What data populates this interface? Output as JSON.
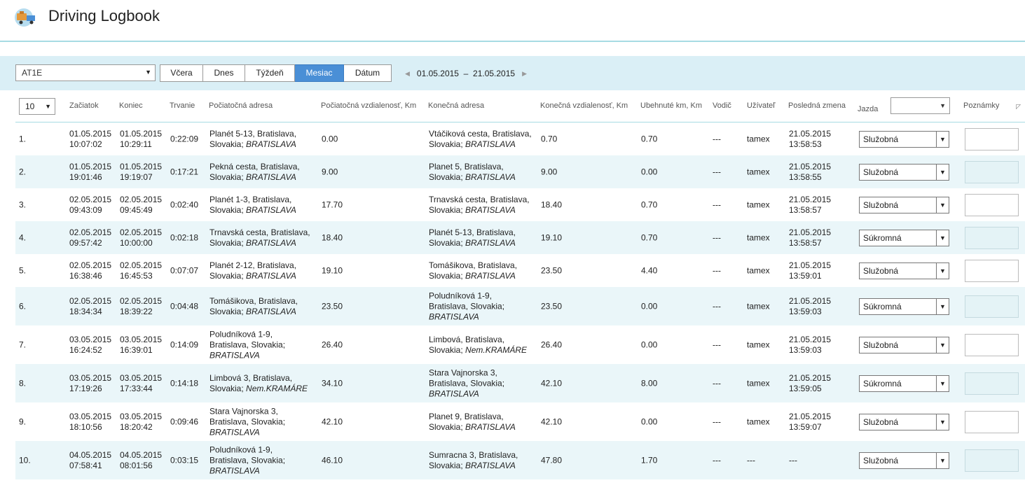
{
  "header": {
    "title": "Driving Logbook",
    "logo_icon": "truck-icon"
  },
  "toolbar": {
    "vehicle": "AT1E",
    "periods": [
      "Včera",
      "Dnes",
      "Týždeň",
      "Mesiac",
      "Dátum"
    ],
    "active_period": "Mesiac",
    "date_from": "01.05.2015",
    "date_sep": "–",
    "date_to": "21.05.2015"
  },
  "table": {
    "page_size": "10",
    "columns": {
      "start": "Začiatok",
      "end": "Koniec",
      "duration": "Trvanie",
      "start_addr": "Počiatočná adresa",
      "start_dist": "Počiatočná vzdialenosť, Km",
      "end_addr": "Konečná adresa",
      "end_dist": "Konečná vzdialenosť, Km",
      "driven": "Ubehnuté km, Km",
      "driver": "Vodič",
      "user": "Užívateľ",
      "last_change": "Posledná zmena",
      "trip": "Jazda",
      "notes": "Poznámky"
    },
    "rows": [
      {
        "n": "1.",
        "sd": "01.05.2015",
        "st": "10:07:02",
        "ed": "01.05.2015",
        "et": "10:29:11",
        "dur": "0:22:09",
        "sa": [
          "Planét 5-13, Bratislava,",
          "Slovakia; "
        ],
        "sc": "BRATISLAVA",
        "sdist": "0.00",
        "ea": [
          "Vtáčiková cesta, Bratislava,",
          "Slovakia; "
        ],
        "ec": "BRATISLAVA",
        "edist": "0.70",
        "km": "0.70",
        "driver": "---",
        "user": "tamex",
        "ld": "21.05.2015",
        "lt": "13:58:53",
        "trip": "Služobná"
      },
      {
        "n": "2.",
        "sd": "01.05.2015",
        "st": "19:01:46",
        "ed": "01.05.2015",
        "et": "19:19:07",
        "dur": "0:17:21",
        "sa": [
          "Pekná cesta, Bratislava,",
          "Slovakia; "
        ],
        "sc": "BRATISLAVA",
        "sdist": "9.00",
        "ea": [
          "Planet 5, Bratislava,",
          "Slovakia; "
        ],
        "ec": "BRATISLAVA",
        "edist": "9.00",
        "km": "0.00",
        "driver": "---",
        "user": "tamex",
        "ld": "21.05.2015",
        "lt": "13:58:55",
        "trip": "Služobná"
      },
      {
        "n": "3.",
        "sd": "02.05.2015",
        "st": "09:43:09",
        "ed": "02.05.2015",
        "et": "09:45:49",
        "dur": "0:02:40",
        "sa": [
          "Planét 1-3, Bratislava,",
          "Slovakia; "
        ],
        "sc": "BRATISLAVA",
        "sdist": "17.70",
        "ea": [
          "Trnavská cesta, Bratislava,",
          "Slovakia; "
        ],
        "ec": "BRATISLAVA",
        "edist": "18.40",
        "km": "0.70",
        "driver": "---",
        "user": "tamex",
        "ld": "21.05.2015",
        "lt": "13:58:57",
        "trip": "Služobná"
      },
      {
        "n": "4.",
        "sd": "02.05.2015",
        "st": "09:57:42",
        "ed": "02.05.2015",
        "et": "10:00:00",
        "dur": "0:02:18",
        "sa": [
          "Trnavská cesta, Bratislava,",
          "Slovakia; "
        ],
        "sc": "BRATISLAVA",
        "sdist": "18.40",
        "ea": [
          "Planét 5-13, Bratislava,",
          "Slovakia; "
        ],
        "ec": "BRATISLAVA",
        "edist": "19.10",
        "km": "0.70",
        "driver": "---",
        "user": "tamex",
        "ld": "21.05.2015",
        "lt": "13:58:57",
        "trip": "Súkromná"
      },
      {
        "n": "5.",
        "sd": "02.05.2015",
        "st": "16:38:46",
        "ed": "02.05.2015",
        "et": "16:45:53",
        "dur": "0:07:07",
        "sa": [
          "Planét 2-12, Bratislava,",
          "Slovakia; "
        ],
        "sc": "BRATISLAVA",
        "sdist": "19.10",
        "ea": [
          "Tomášikova, Bratislava,",
          "Slovakia; "
        ],
        "ec": "BRATISLAVA",
        "edist": "23.50",
        "km": "4.40",
        "driver": "---",
        "user": "tamex",
        "ld": "21.05.2015",
        "lt": "13:59:01",
        "trip": "Služobná"
      },
      {
        "n": "6.",
        "sd": "02.05.2015",
        "st": "18:34:34",
        "ed": "02.05.2015",
        "et": "18:39:22",
        "dur": "0:04:48",
        "sa": [
          "Tomášikova, Bratislava,",
          "Slovakia; "
        ],
        "sc": "BRATISLAVA",
        "sdist": "23.50",
        "ea": [
          "Poludníková 1-9,",
          "Bratislava, Slovakia;"
        ],
        "ec": "BRATISLAVA",
        "edist": "23.50",
        "km": "0.00",
        "driver": "---",
        "user": "tamex",
        "ld": "21.05.2015",
        "lt": "13:59:03",
        "trip": "Súkromná"
      },
      {
        "n": "7.",
        "sd": "03.05.2015",
        "st": "16:24:52",
        "ed": "03.05.2015",
        "et": "16:39:01",
        "dur": "0:14:09",
        "sa": [
          "Poludníková 1-9,",
          "Bratislava, Slovakia;"
        ],
        "sc": "BRATISLAVA",
        "sdist": "26.40",
        "ea": [
          "Limbová, Bratislava,",
          "Slovakia; "
        ],
        "ec": "Nem.KRAMÁRE",
        "edist": "26.40",
        "km": "0.00",
        "driver": "---",
        "user": "tamex",
        "ld": "21.05.2015",
        "lt": "13:59:03",
        "trip": "Služobná"
      },
      {
        "n": "8.",
        "sd": "03.05.2015",
        "st": "17:19:26",
        "ed": "03.05.2015",
        "et": "17:33:44",
        "dur": "0:14:18",
        "sa": [
          "Limbová 3, Bratislava,",
          "Slovakia; "
        ],
        "sc": "Nem.KRAMÁRE",
        "sdist": "34.10",
        "ea": [
          "Stara Vajnorska 3,",
          "Bratislava, Slovakia;"
        ],
        "ec": "BRATISLAVA",
        "edist": "42.10",
        "km": "8.00",
        "driver": "---",
        "user": "tamex",
        "ld": "21.05.2015",
        "lt": "13:59:05",
        "trip": "Súkromná"
      },
      {
        "n": "9.",
        "sd": "03.05.2015",
        "st": "18:10:56",
        "ed": "03.05.2015",
        "et": "18:20:42",
        "dur": "0:09:46",
        "sa": [
          "Stara Vajnorska 3,",
          "Bratislava, Slovakia;"
        ],
        "sc": "BRATISLAVA",
        "sdist": "42.10",
        "ea": [
          "Planet 9, Bratislava,",
          "Slovakia; "
        ],
        "ec": "BRATISLAVA",
        "edist": "42.10",
        "km": "0.00",
        "driver": "---",
        "user": "tamex",
        "ld": "21.05.2015",
        "lt": "13:59:07",
        "trip": "Služobná"
      },
      {
        "n": "10.",
        "sd": "04.05.2015",
        "st": "07:58:41",
        "ed": "04.05.2015",
        "et": "08:01:56",
        "dur": "0:03:15",
        "sa": [
          "Poludníková 1-9,",
          "Bratislava, Slovakia;"
        ],
        "sc": "BRATISLAVA",
        "sdist": "46.10",
        "ea": [
          "Sumracna 3, Bratislava,",
          "Slovakia; "
        ],
        "ec": "BRATISLAVA",
        "edist": "47.80",
        "km": "1.70",
        "driver": "---",
        "user": "---",
        "ld": "---",
        "lt": "",
        "trip": "Služobná"
      }
    ]
  }
}
